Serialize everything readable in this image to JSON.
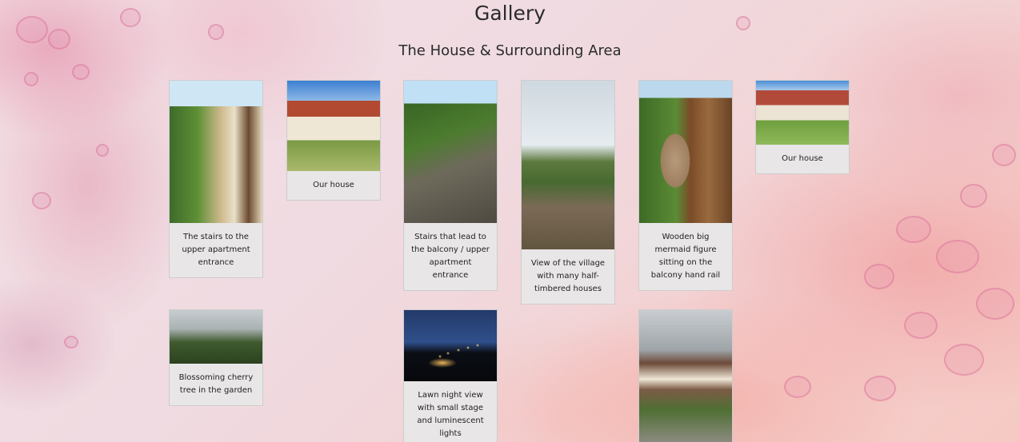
{
  "page": {
    "title": "Gallery",
    "section_title": "The House & Surrounding Area"
  },
  "gallery": {
    "items": [
      {
        "caption": "The stairs to the upper apartment entrance",
        "photo": "stairs-to-upper-apartment-photo"
      },
      {
        "caption": "Our house",
        "photo": "our-house-photo"
      },
      {
        "caption": "Stairs that lead to the balcony / upper apartment entrance",
        "photo": "balcony-stairs-photo"
      },
      {
        "caption": "View of the village with many half-timbered houses",
        "photo": "village-view-photo"
      },
      {
        "caption": "Wooden big mermaid figure sitting on the balcony hand rail",
        "photo": "wooden-mermaid-photo"
      },
      {
        "caption": "Our house",
        "photo": "our-house-photo-2"
      },
      {
        "caption": "Blossoming cherry tree in the garden",
        "photo": "cherry-tree-photo"
      },
      {
        "caption": "Lawn night view with small stage and luminescent lights",
        "photo": "lawn-night-photo"
      },
      {
        "caption": "",
        "photo": "village-path-photo"
      }
    ]
  },
  "colors": {
    "card_background": "#e8e6e6",
    "text": "#2b2b2b",
    "background_accent": "#e89aa8"
  }
}
